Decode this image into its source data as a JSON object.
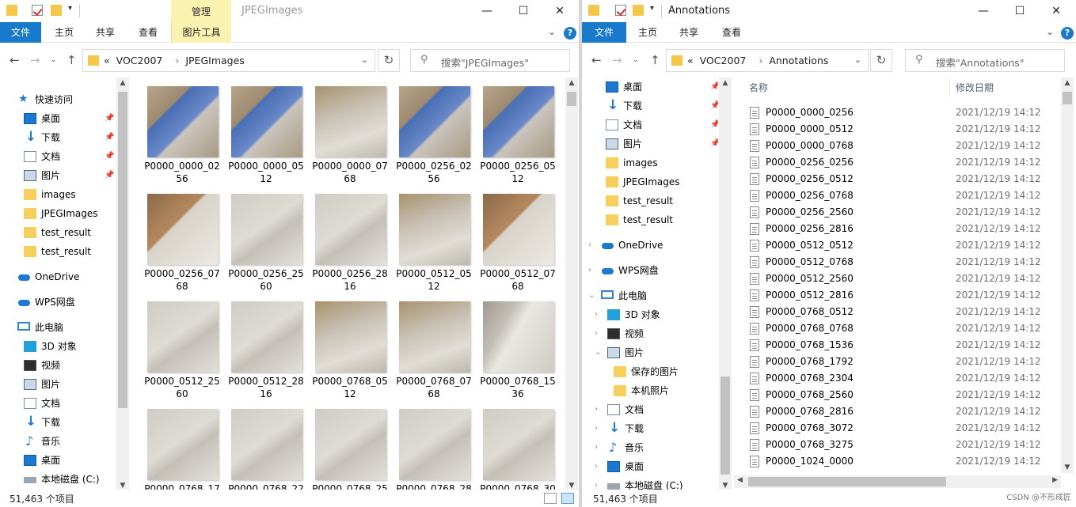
{
  "left_window": {
    "title": "JPEGImages",
    "context_tab": "管理",
    "ribbon_tabs": [
      "文件",
      "主页",
      "共享",
      "查看",
      "图片工具"
    ],
    "address": {
      "overflow": "«",
      "crumbs": [
        "VOC2007",
        "JPEGImages"
      ]
    },
    "search_placeholder": "搜索\"JPEGImages\"",
    "nav": {
      "quick_access": "快速访问",
      "items": [
        "桌面",
        "下载",
        "文档",
        "图片",
        "images",
        "JPEGImages",
        "test_result",
        "test_result"
      ],
      "onedrive": "OneDrive",
      "wps": "WPS网盘",
      "this_pc": "此电脑",
      "pc_items": [
        "3D 对象",
        "视频",
        "图片",
        "文档",
        "下载",
        "音乐",
        "桌面",
        "本地磁盘 (C:)"
      ]
    },
    "thumbnails": [
      {
        "name": "P0000_0000_0256",
        "tone": "roof"
      },
      {
        "name": "P0000_0000_0512",
        "tone": "roof"
      },
      {
        "name": "P0000_0000_0768",
        "tone": "mix"
      },
      {
        "name": "P0000_0256_0256",
        "tone": "roof"
      },
      {
        "name": "P0000_0256_0512",
        "tone": "roof"
      },
      {
        "name": "P0000_0256_0768",
        "tone": "field"
      },
      {
        "name": "P0000_0256_2560",
        "tone": "apron"
      },
      {
        "name": "P0000_0256_2816",
        "tone": "apron"
      },
      {
        "name": "P0000_0512_0512",
        "tone": "mix"
      },
      {
        "name": "P0000_0512_0768",
        "tone": "field"
      },
      {
        "name": "P0000_0512_2560",
        "tone": "apron"
      },
      {
        "name": "P0000_0512_2816",
        "tone": "apron"
      },
      {
        "name": "P0000_0768_0512",
        "tone": "mix"
      },
      {
        "name": "P0000_0768_0768",
        "tone": "mix"
      },
      {
        "name": "P0000_0768_1536",
        "tone": "road"
      },
      {
        "name": "P0000_0768_17",
        "tone": "apron"
      },
      {
        "name": "P0000_0768_22",
        "tone": "apron"
      },
      {
        "name": "P0000_0768_25",
        "tone": "apron"
      },
      {
        "name": "P0000_0768_28",
        "tone": "apron"
      },
      {
        "name": "P0000_0768_30",
        "tone": "apron"
      }
    ],
    "status": "51,463 个项目"
  },
  "right_window": {
    "title": "Annotations",
    "ribbon_tabs": [
      "文件",
      "主页",
      "共享",
      "查看"
    ],
    "address": {
      "overflow": "«",
      "crumbs": [
        "VOC2007",
        "Annotations"
      ]
    },
    "search_placeholder": "搜索\"Annotations\"",
    "nav": {
      "items": [
        "桌面",
        "下载",
        "文档",
        "图片",
        "images",
        "JPEGImages",
        "test_result",
        "test_result"
      ],
      "onedrive": "OneDrive",
      "wps": "WPS网盘",
      "this_pc": "此电脑",
      "pc_items": [
        "3D 对象",
        "视频",
        "图片"
      ],
      "pic_sub": [
        "保存的图片",
        "本机照片"
      ],
      "pc_items2": [
        "文档",
        "下载",
        "音乐",
        "桌面",
        "本地磁盘 (C:)"
      ]
    },
    "columns": {
      "name": "名称",
      "date": "修改日期"
    },
    "files": [
      {
        "name": "P0000_0000_0256",
        "date": "2021/12/19 14:12"
      },
      {
        "name": "P0000_0000_0512",
        "date": "2021/12/19 14:12"
      },
      {
        "name": "P0000_0000_0768",
        "date": "2021/12/19 14:12"
      },
      {
        "name": "P0000_0256_0256",
        "date": "2021/12/19 14:12"
      },
      {
        "name": "P0000_0256_0512",
        "date": "2021/12/19 14:12"
      },
      {
        "name": "P0000_0256_0768",
        "date": "2021/12/19 14:12"
      },
      {
        "name": "P0000_0256_2560",
        "date": "2021/12/19 14:12"
      },
      {
        "name": "P0000_0256_2816",
        "date": "2021/12/19 14:12"
      },
      {
        "name": "P0000_0512_0512",
        "date": "2021/12/19 14:12"
      },
      {
        "name": "P0000_0512_0768",
        "date": "2021/12/19 14:12"
      },
      {
        "name": "P0000_0512_2560",
        "date": "2021/12/19 14:12"
      },
      {
        "name": "P0000_0512_2816",
        "date": "2021/12/19 14:12"
      },
      {
        "name": "P0000_0768_0512",
        "date": "2021/12/19 14:12"
      },
      {
        "name": "P0000_0768_0768",
        "date": "2021/12/19 14:12"
      },
      {
        "name": "P0000_0768_1536",
        "date": "2021/12/19 14:12"
      },
      {
        "name": "P0000_0768_1792",
        "date": "2021/12/19 14:12"
      },
      {
        "name": "P0000_0768_2304",
        "date": "2021/12/19 14:12"
      },
      {
        "name": "P0000_0768_2560",
        "date": "2021/12/19 14:12"
      },
      {
        "name": "P0000_0768_2816",
        "date": "2021/12/19 14:12"
      },
      {
        "name": "P0000_0768_3072",
        "date": "2021/12/19 14:12"
      },
      {
        "name": "P0000_0768_3275",
        "date": "2021/12/19 14:12"
      },
      {
        "name": "P0000_1024_0000",
        "date": "2021/12/19 14:12"
      }
    ],
    "status": "51,463 个项目"
  },
  "watermark": "CSDN @不形成匠",
  "colors": {
    "accent": "#1979ca",
    "context_tab": "#fbf1b0",
    "folder": "#f6cf5c"
  }
}
